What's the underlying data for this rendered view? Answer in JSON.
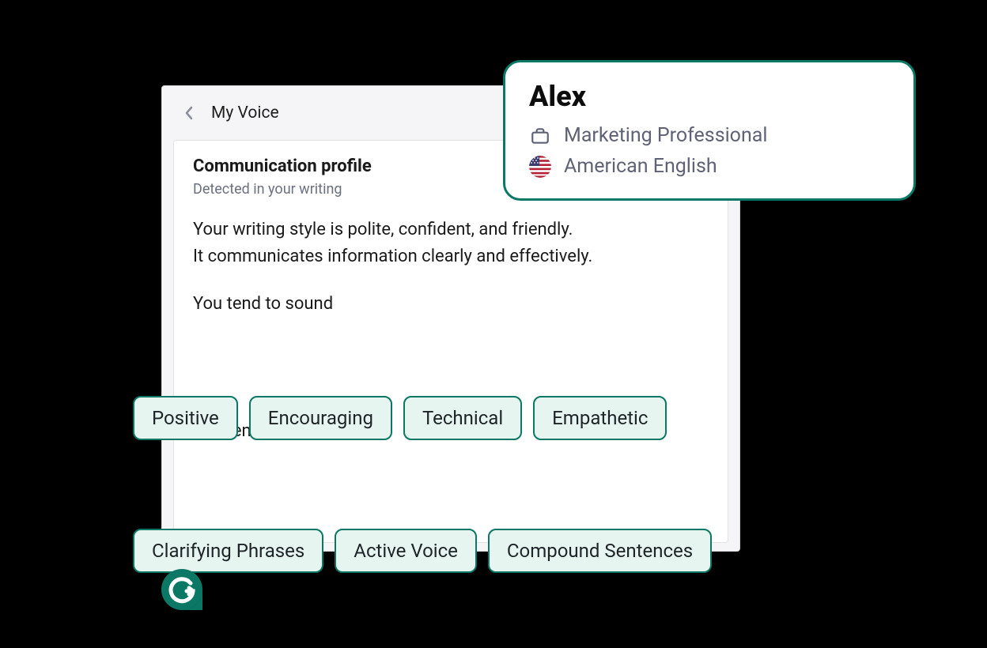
{
  "panel": {
    "title": "My Voice"
  },
  "profile_section": {
    "heading": "Communication profile",
    "subheading": "Detected in your writing",
    "description_line1": "Your writing style is polite, confident, and friendly.",
    "description_line2": "It communicates information clearly and effectively.",
    "sound_label": "You tend to sound",
    "use_label": "You tend to use"
  },
  "sound_tags": [
    "Positive",
    "Encouraging",
    "Technical",
    "Empathetic"
  ],
  "use_tags": [
    "Clarifying Phrases",
    "Active Voice",
    "Compound Sentences"
  ],
  "user_card": {
    "name": "Alex",
    "role": "Marketing Professional",
    "language": "American English"
  },
  "colors": {
    "accent": "#0b7765",
    "tag_bg": "#e6f5f0"
  }
}
